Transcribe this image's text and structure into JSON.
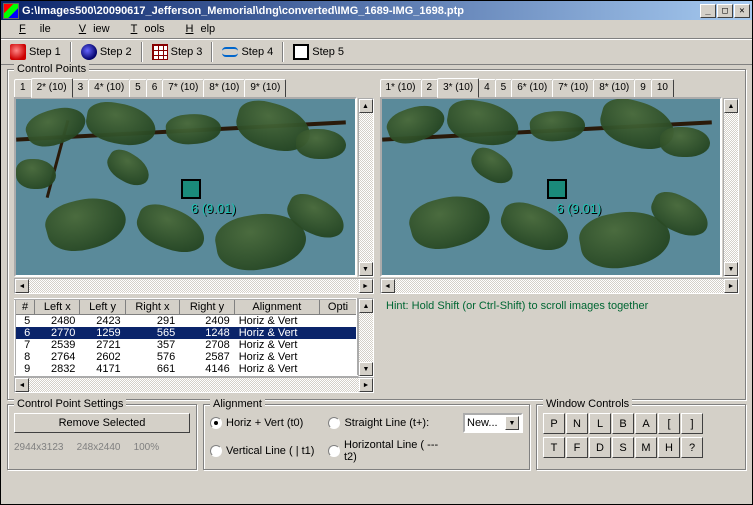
{
  "title": "G:\\Images500\\20090617_Jefferson_Memorial\\dng\\converted\\IMG_1689-IMG_1698.ptp",
  "menu": {
    "file": "File",
    "view": "View",
    "tools": "Tools",
    "help": "Help"
  },
  "steps": {
    "s1": "Step 1",
    "s2": "Step 2",
    "s3": "Step 3",
    "s4": "Step 4",
    "s5": "Step 5"
  },
  "cp_legend": "Control Points",
  "left_tabs": [
    "1",
    "2* (10)",
    "3",
    "4* (10)",
    "5",
    "6",
    "7* (10)",
    "8* (10)",
    "9* (10)"
  ],
  "left_active": 1,
  "right_tabs": [
    "1* (10)",
    "2",
    "3* (10)",
    "4",
    "5",
    "6* (10)",
    "7* (10)",
    "8* (10)",
    "9",
    "10"
  ],
  "right_active": 2,
  "marker_label": "6 (9.01)",
  "table": {
    "headers": [
      "#",
      "Left x",
      "Left y",
      "Right x",
      "Right y",
      "Alignment",
      "Opti"
    ],
    "rows": [
      {
        "n": "5",
        "lx": "2480",
        "ly": "2423",
        "rx": "291",
        "ry": "2409",
        "al": "Horiz & Vert"
      },
      {
        "n": "6",
        "lx": "2770",
        "ly": "1259",
        "rx": "565",
        "ry": "1248",
        "al": "Horiz & Vert",
        "sel": true
      },
      {
        "n": "7",
        "lx": "2539",
        "ly": "2721",
        "rx": "357",
        "ry": "2708",
        "al": "Horiz & Vert"
      },
      {
        "n": "8",
        "lx": "2764",
        "ly": "2602",
        "rx": "576",
        "ry": "2587",
        "al": "Horiz & Vert"
      },
      {
        "n": "9",
        "lx": "2832",
        "ly": "4171",
        "rx": "661",
        "ry": "4146",
        "al": "Horiz & Vert"
      }
    ]
  },
  "hint": "Hint: Hold Shift (or Ctrl-Shift) to scroll images together",
  "cps": {
    "legend": "Control Point Settings",
    "remove": "Remove Selected",
    "dim1": "2944x3123",
    "dim2": "248x2440",
    "pct": "100%"
  },
  "align": {
    "legend": "Alignment",
    "hv": "Horiz + Vert (t0)",
    "sl": "Straight Line (t+):",
    "vl": "Vertical Line ( | t1)",
    "hl": "Horizontal Line ( --- t2)",
    "select": "New..."
  },
  "wc": {
    "legend": "Window Controls",
    "row1": [
      "P",
      "N",
      "L",
      "B",
      "A",
      "[",
      "]"
    ],
    "row2": [
      "T",
      "F",
      "D",
      "S",
      "M",
      "H",
      "?"
    ]
  }
}
